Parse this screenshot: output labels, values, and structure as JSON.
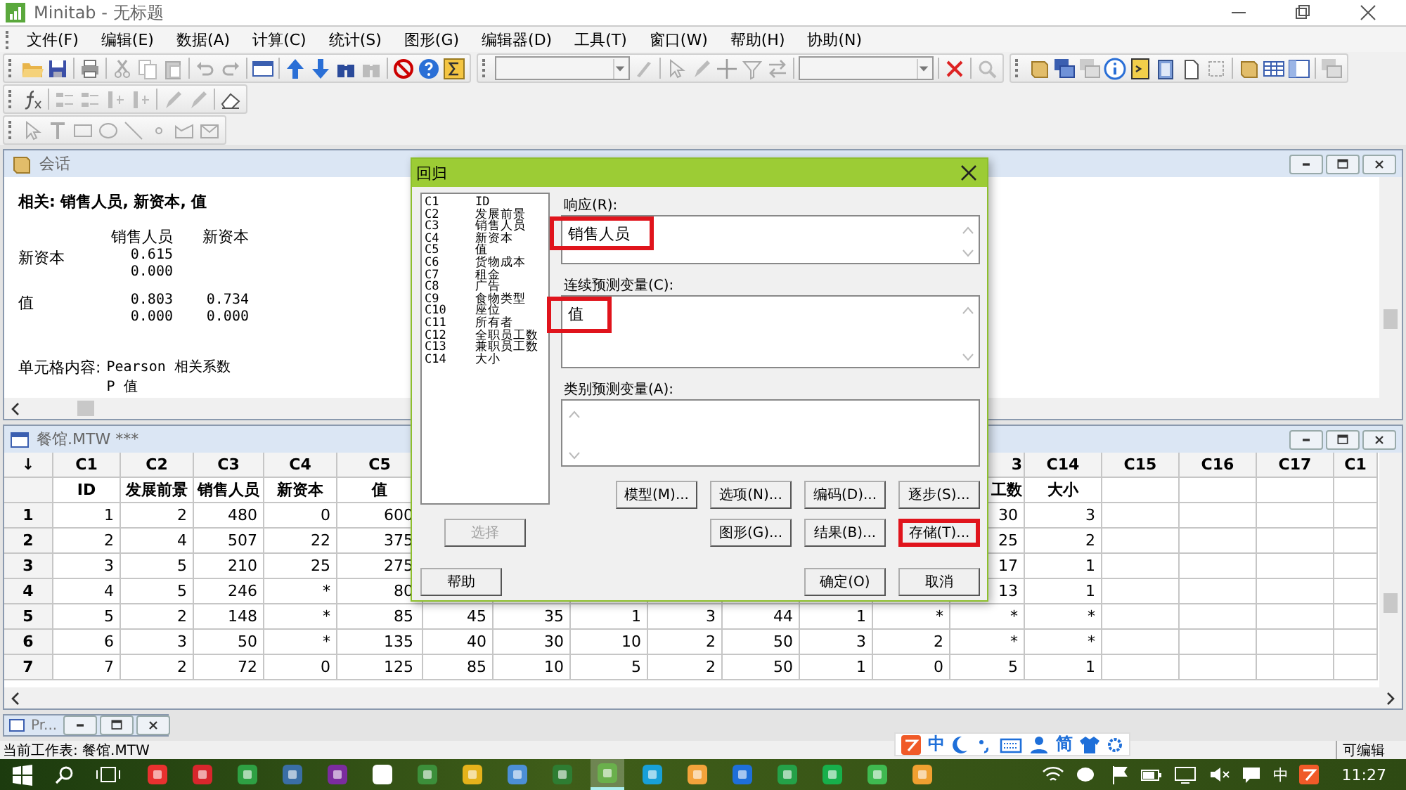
{
  "app_window": {
    "title": "Minitab - 无标题"
  },
  "menu": [
    "文件(F)",
    "编辑(E)",
    "数据(A)",
    "计算(C)",
    "统计(S)",
    "图形(G)",
    "编辑器(D)",
    "工具(T)",
    "窗口(W)",
    "帮助(H)",
    "协助(N)"
  ],
  "session": {
    "title": "会话",
    "heading": "相关: 销售人员, 新资本, 值",
    "columns": [
      "销售人员",
      "新资本"
    ],
    "rows": [
      {
        "label": "新资本",
        "cells": [
          {
            "r": "0.615",
            "p": "0.000"
          }
        ]
      },
      {
        "label": "值",
        "cells": [
          {
            "r": "0.803",
            "p": "0.000"
          },
          {
            "r": "0.734",
            "p": "0.000"
          }
        ]
      }
    ],
    "footer_label": "单元格内容:",
    "footer_lines": [
      "Pearson 相关系数",
      "P 值"
    ]
  },
  "worksheet": {
    "title": "餐馆.MTW ***",
    "corner": "↓",
    "columns": [
      {
        "id": "C1",
        "name": "ID"
      },
      {
        "id": "C2",
        "name": "发展前景"
      },
      {
        "id": "C3",
        "name": "销售人员"
      },
      {
        "id": "C4",
        "name": "新资本"
      },
      {
        "id": "C5",
        "name": "值"
      },
      null,
      null,
      null,
      null,
      null,
      null,
      null,
      {
        "id": "3",
        "name": "工数"
      },
      {
        "id": "C14",
        "name": "大小"
      },
      {
        "id": "C15"
      },
      {
        "id": "C16"
      },
      {
        "id": "C17"
      },
      {
        "id": "C1"
      }
    ],
    "rows": [
      {
        "n": "1",
        "cells": [
          "1",
          "2",
          "480",
          "0",
          "600",
          null,
          null,
          null,
          null,
          null,
          null,
          null,
          "30",
          "3"
        ]
      },
      {
        "n": "2",
        "cells": [
          "2",
          "4",
          "507",
          "22",
          "375",
          null,
          null,
          null,
          null,
          null,
          null,
          null,
          "25",
          "2"
        ]
      },
      {
        "n": "3",
        "cells": [
          "3",
          "5",
          "210",
          "25",
          "275",
          null,
          null,
          null,
          null,
          null,
          null,
          null,
          "17",
          "1"
        ]
      },
      {
        "n": "4",
        "cells": [
          "4",
          "5",
          "246",
          "*",
          "80",
          null,
          null,
          null,
          null,
          null,
          null,
          null,
          "13",
          "1"
        ]
      },
      {
        "n": "5",
        "cells": [
          "5",
          "2",
          "148",
          "*",
          "85",
          "45",
          "35",
          "1",
          "3",
          "44",
          "1",
          "*",
          "*",
          "*"
        ]
      },
      {
        "n": "6",
        "cells": [
          "6",
          "3",
          "50",
          "*",
          "135",
          "40",
          "30",
          "10",
          "2",
          "50",
          "3",
          "2",
          "*",
          "*"
        ]
      },
      {
        "n": "7",
        "cells": [
          "7",
          "2",
          "72",
          "0",
          "125",
          "85",
          "10",
          "5",
          "2",
          "50",
          "1",
          "0",
          "5",
          "1"
        ]
      }
    ]
  },
  "minimized_window": {
    "title": "Pr..."
  },
  "dialog": {
    "title": "回归",
    "variables": [
      {
        "column": "C1",
        "name": "ID"
      },
      {
        "column": "C2",
        "name": "发展前景"
      },
      {
        "column": "C3",
        "name": "销售人员"
      },
      {
        "column": "C4",
        "name": "新资本"
      },
      {
        "column": "C5",
        "name": "值"
      },
      {
        "column": "C6",
        "name": "货物成本"
      },
      {
        "column": "C7",
        "name": "租金"
      },
      {
        "column": "C8",
        "name": "广告"
      },
      {
        "column": "C9",
        "name": "食物类型"
      },
      {
        "column": "C10",
        "name": "座位"
      },
      {
        "column": "C11",
        "name": "所有者"
      },
      {
        "column": "C12",
        "name": "全职员工数"
      },
      {
        "column": "C13",
        "name": "兼职员工数"
      },
      {
        "column": "C14",
        "name": "大小"
      }
    ],
    "fields": [
      {
        "label": "响应(R):",
        "value": "销售人员",
        "highlighted": true
      },
      {
        "label": "连续预测变量(C):",
        "value": "值",
        "highlighted": true
      },
      {
        "label": "类别预测变量(A):",
        "highlighted": false
      }
    ],
    "select_button": {
      "label": "选择",
      "disabled": true
    },
    "option_buttons": [
      [
        {
          "label": "模型(M)...",
          "highlighted": false
        },
        {
          "label": "选项(N)...",
          "highlighted": false
        },
        {
          "label": "编码(D)...",
          "highlighted": false
        },
        {
          "label": "逐步(S)...",
          "highlighted": false
        }
      ],
      [
        {
          "label": "图形(G)...",
          "highlighted": false
        },
        {
          "label": "结果(B)...",
          "highlighted": false
        },
        {
          "label": "存储(T)...",
          "highlighted": true
        }
      ]
    ],
    "help_button": "帮助",
    "ok_button": "确定(O)",
    "cancel_button": "取消"
  },
  "status_bar": {
    "worksheet": "当前工作表: 餐馆.MTW",
    "mode": "可编辑"
  },
  "ime_bar": {
    "language": "中",
    "script": "简"
  },
  "taskbar": {
    "input_language": "中",
    "time": "11:27"
  }
}
